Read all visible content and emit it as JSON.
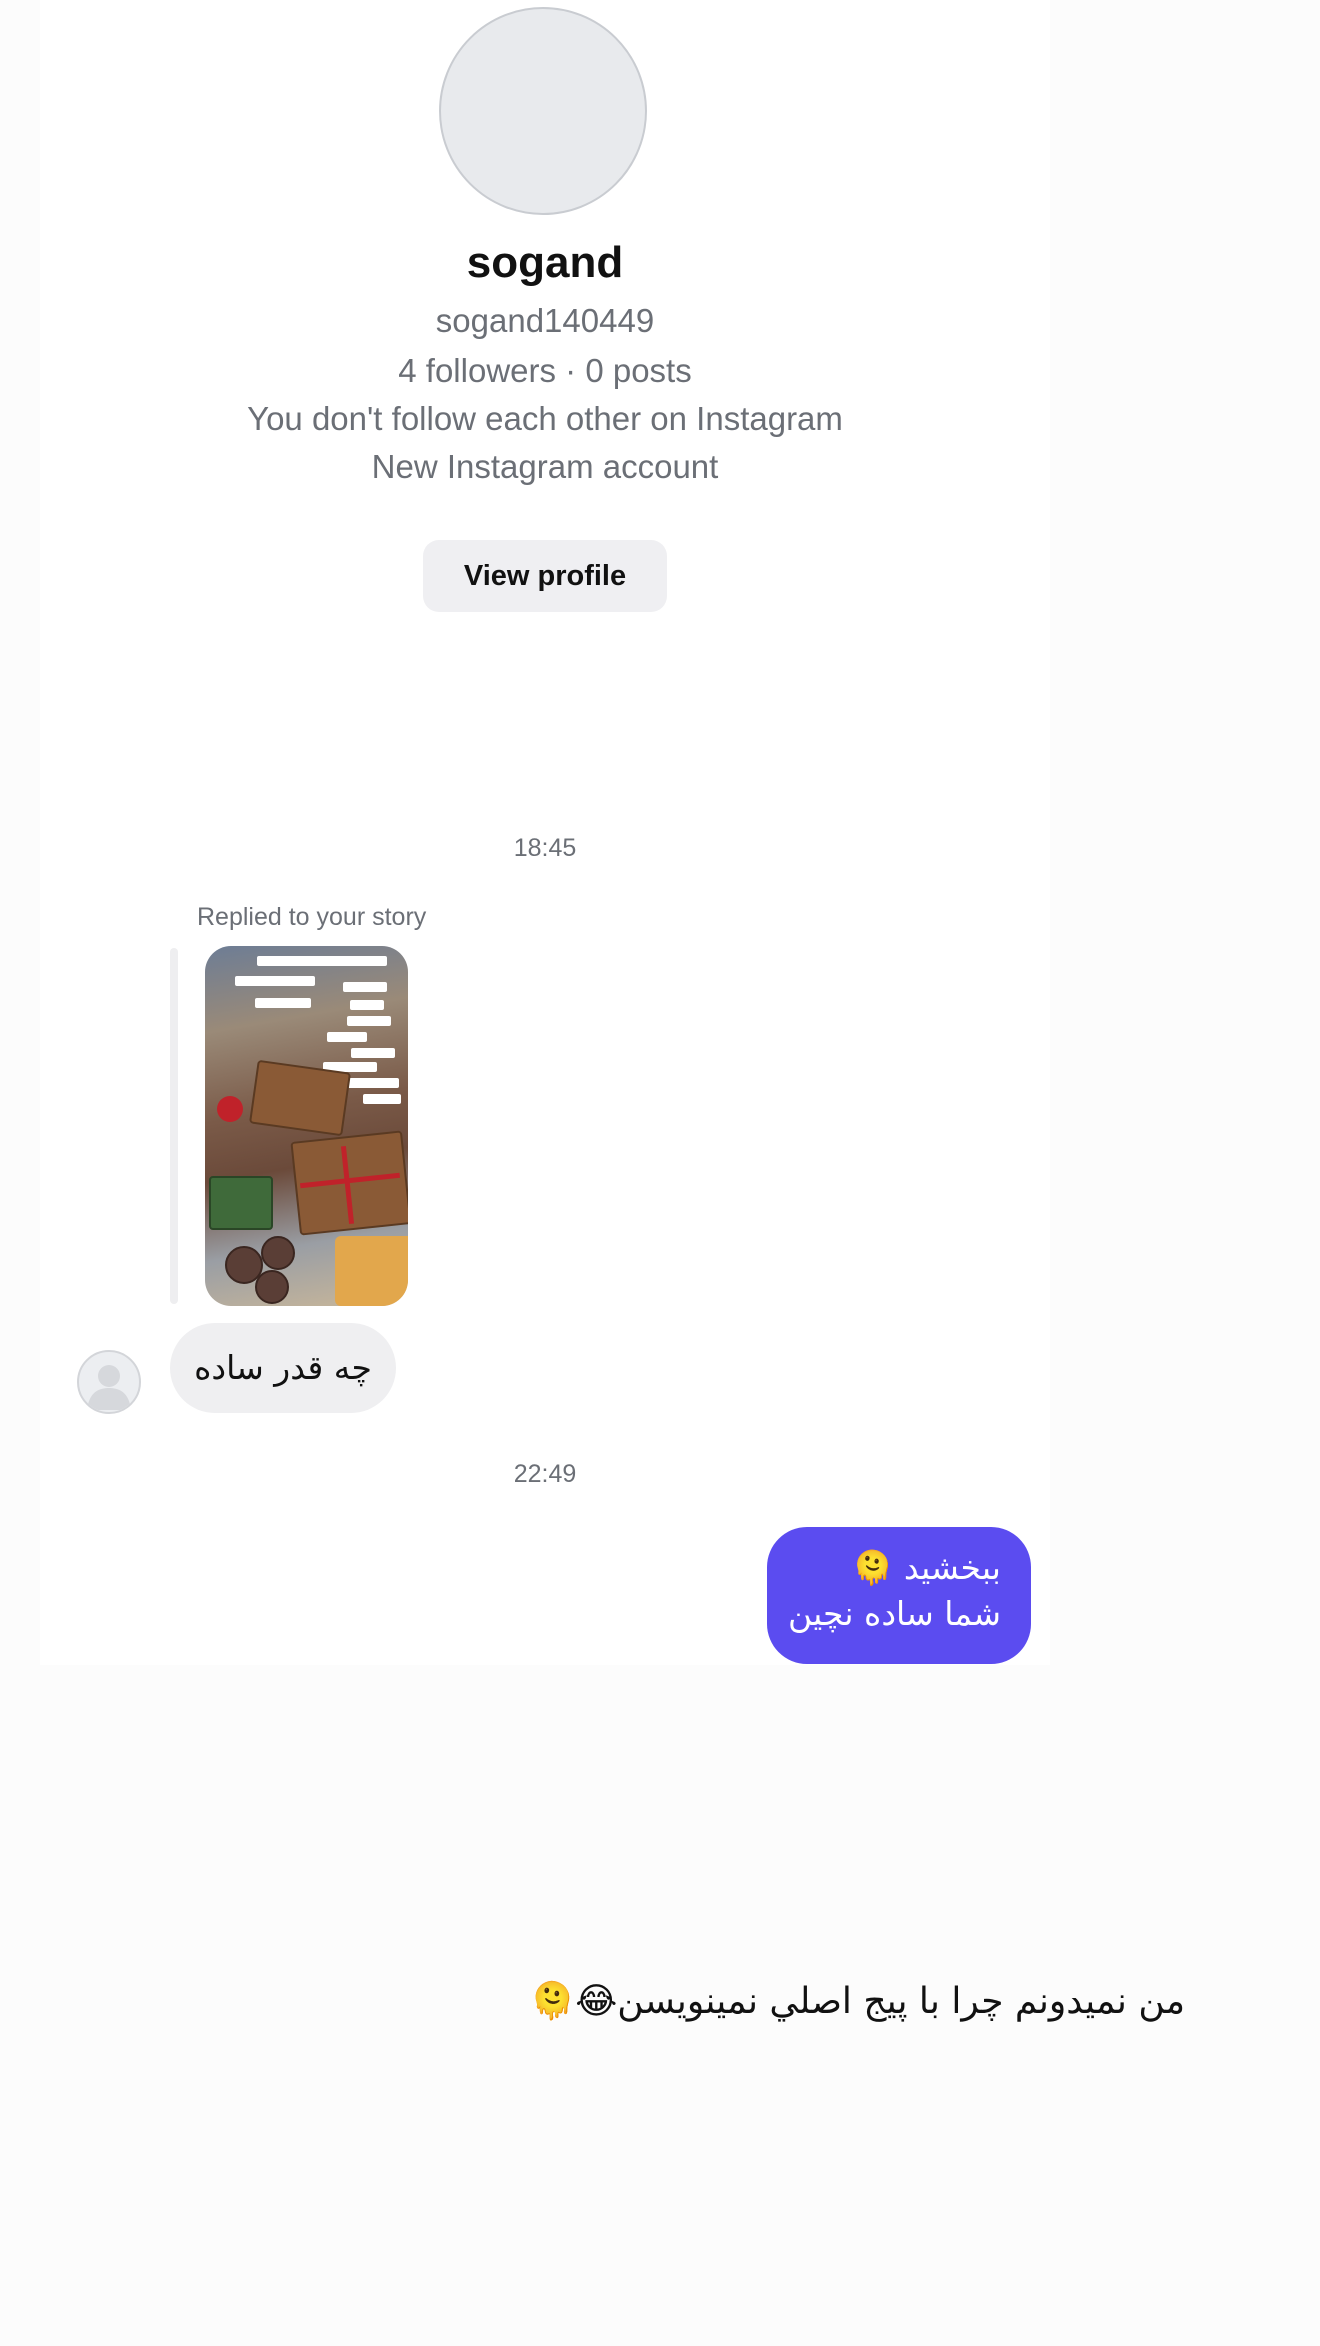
{
  "profile": {
    "display_name": "sogand",
    "username": "sogand140449",
    "stats": "4 followers · 0 posts",
    "relationship": "You don't follow each other on Instagram",
    "account_note": "New Instagram account",
    "view_profile_label": "View profile"
  },
  "thread": {
    "timestamp_1": "18:45",
    "reply_label": "Replied to your story",
    "incoming_message": "چه قدر ساده",
    "timestamp_2": "22:49",
    "outgoing_message_line1": "ببخشید 🫠",
    "outgoing_message_line2": "شما ساده نچین"
  },
  "caption": "من نمیدونم چرا با پیج اصلي نمینویسن😂🫠",
  "colors": {
    "accent": "#5b4cf0",
    "incoming_bubble": "#efeff1",
    "button_bg": "#efeff2",
    "muted_text": "#6b6f76"
  }
}
